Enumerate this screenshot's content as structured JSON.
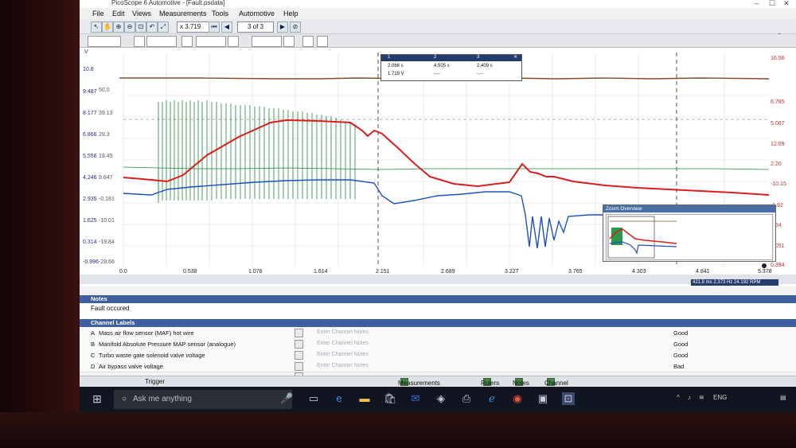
{
  "window": {
    "title": "PicoScope 6 Automotive - [Fault.psdata]",
    "logo": "pic"
  },
  "menu": [
    "File",
    "Edit",
    "Views",
    "Measurements",
    "Tools",
    "Automotive",
    "Help"
  ],
  "toolbar": {
    "zoom_value": "x 3.719",
    "page_indicator": "3 of 3"
  },
  "graph": {
    "left_axis_a": [
      "10.8",
      "9.487",
      "8.177",
      "6.866",
      "5.556",
      "4.246",
      "2.935",
      "1.625",
      "0.314",
      "-0.996"
    ],
    "left_axis_b": [
      "50.0",
      "39.13",
      "29.3",
      "19.45",
      "9.647",
      "-0.181",
      "-10.01",
      "-19.84",
      "-29.66"
    ],
    "left_axis_unit": "V",
    "right_axis_a": [
      "16.56",
      "6.785",
      "5.087",
      "12.09",
      "2.20",
      "-10.15",
      "-1.82",
      "1.54",
      "0.051",
      "0.394"
    ],
    "x_ticks": [
      "0.0",
      "0.538",
      "1.076",
      "1.614",
      "2.151",
      "2.689",
      "3.227",
      "3.765",
      "4.303",
      "4.841",
      "5.378"
    ],
    "x_unit": "s",
    "ruler_readout": "421.8 ms  2.373 Hz  24.192 RPM",
    "measurements": {
      "header": [
        "1",
        "2",
        "3"
      ],
      "row1": [
        "2.066 s",
        "4.505 s",
        "2.409 s"
      ],
      "row2": [
        "1.719 V",
        "-.--",
        "-.--"
      ]
    },
    "zoom_overview_title": "Zoom Overview"
  },
  "notes": {
    "header": "Notes",
    "text": "Fault occured"
  },
  "channel_labels": {
    "header": "Channel Labels",
    "placeholder": "Enter Channel Notes",
    "rows": [
      {
        "letter": "A",
        "name": "Mass air flow sensor (MAF) hot wire",
        "status": "Good"
      },
      {
        "letter": "B",
        "name": "Manifold Absolute Pressure MAP sensor (analogue)",
        "status": "Good"
      },
      {
        "letter": "C",
        "name": "Turbo waste gate solenoid valve voltage",
        "status": "Good"
      },
      {
        "letter": "D",
        "name": "Air bypass valve voltage",
        "status": "Bad"
      }
    ]
  },
  "bottombar": {
    "trigger": "Trigger",
    "measurements": "Measurements",
    "rulers": "Rulers",
    "notes": "Notes",
    "channel_labels": "Channel Labels"
  },
  "taskbar": {
    "search_placeholder": "Ask me anything",
    "lang": "ENG"
  },
  "colors": {
    "channel_a": "#d81e1e",
    "channel_b": "#1f4fc0",
    "channel_c": "#1f8a3a",
    "channel_d": "#8a4a2a",
    "section_header": "#3f5f9e"
  }
}
